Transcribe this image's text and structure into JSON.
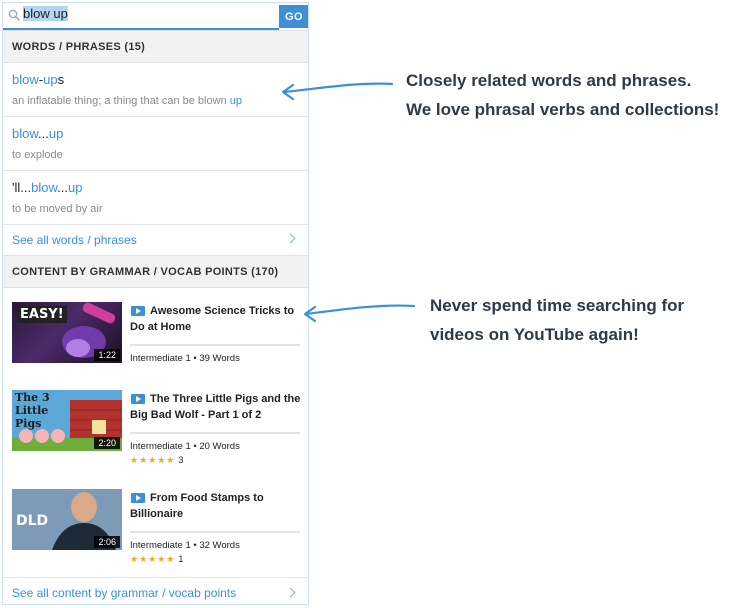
{
  "search": {
    "value": "blow up",
    "go_label": "GO"
  },
  "words_section": {
    "header": "WORDS / PHRASES (15)",
    "items": [
      {
        "title_parts": [
          {
            "t": "blow",
            "hl": true
          },
          {
            "t": "-",
            "hl": false
          },
          {
            "t": "up",
            "hl": true
          },
          {
            "t": "s",
            "hl": false
          }
        ],
        "def_parts": [
          {
            "t": "an inflatable thing; a thing that can be blown ",
            "hl": false
          },
          {
            "t": "up",
            "hl": true
          }
        ]
      },
      {
        "title_parts": [
          {
            "t": "blow",
            "hl": true
          },
          {
            "t": "...",
            "hl": false
          },
          {
            "t": "up",
            "hl": true
          }
        ],
        "def_parts": [
          {
            "t": "to explode",
            "hl": false
          }
        ]
      },
      {
        "title_parts": [
          {
            "t": "'ll...",
            "hl": false
          },
          {
            "t": "blow",
            "hl": true
          },
          {
            "t": "...",
            "hl": false
          },
          {
            "t": "up",
            "hl": true
          }
        ],
        "def_parts": [
          {
            "t": "to be moved by air",
            "hl": false
          }
        ]
      }
    ],
    "see_all": "See all words / phrases"
  },
  "content_section": {
    "header": "CONTENT BY GRAMMAR / VOCAB POINTS (170)",
    "videos": [
      {
        "title": "Awesome Science Tricks to Do at Home",
        "duration": "1:22",
        "meta": "Intermediate 1 • 39 Words",
        "stars": "★★★★★",
        "rating_count": "",
        "thumb_text": "EASY!"
      },
      {
        "title": "The Three Little Pigs and the Big Bad Wolf - Part 1 of 2",
        "duration": "2:20",
        "meta": "Intermediate 1 • 20 Words",
        "stars": "★★★★★",
        "rating_count": "3",
        "thumb_text": "The 3 Little Pigs"
      },
      {
        "title": "From Food Stamps to Billionaire",
        "duration": "2:06",
        "meta": "Intermediate 1 • 32 Words",
        "stars": "★★★★★",
        "rating_count": "1",
        "thumb_text": "DLD"
      }
    ],
    "see_all": "See all content by grammar / vocab points"
  },
  "annotations": [
    {
      "line1": "Closely related words and phrases.",
      "line2": "We love phrasal verbs and collections!"
    },
    {
      "line1": "Never spend time searching for",
      "line2": "videos on YouTube again!"
    }
  ],
  "colors": {
    "accent": "#3d8fd6",
    "star": "#f5a623"
  }
}
